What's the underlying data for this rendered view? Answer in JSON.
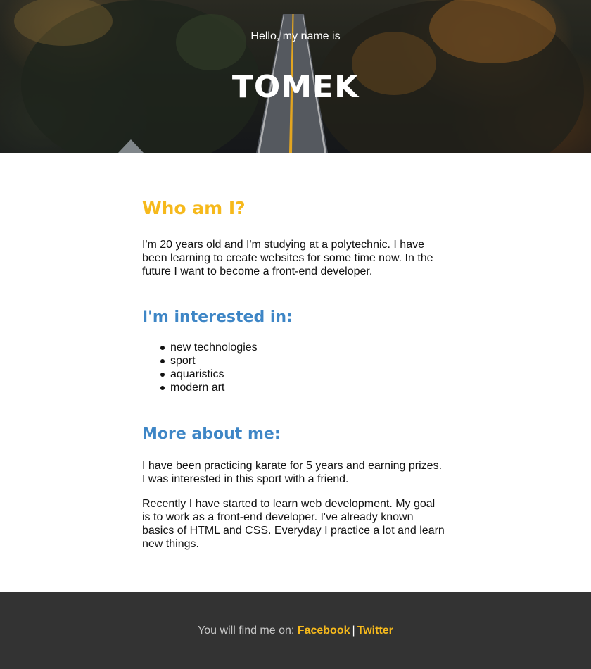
{
  "hero": {
    "greeting": "Hello, my name is",
    "name": "TOMEK"
  },
  "about": {
    "heading": "Who am I?",
    "text": "I'm 20 years old and I'm studying at a polytechnic. I have been learning to create websites for some time now. In the future I want to become a front-end developer."
  },
  "interests": {
    "heading": "I'm interested in:",
    "items": [
      "new technologies",
      "sport",
      "aquaristics",
      "modern art"
    ]
  },
  "more": {
    "heading": "More about me:",
    "paragraph1": "I have been practicing karate for 5 years and earning prizes. I was interested in this sport with a friend.",
    "paragraph2": "Recently I have started to learn web development. My goal is to work as a front-end developer. I've already known basics of HTML and CSS. Everyday I practice a lot and learn new things."
  },
  "footer": {
    "prefix": "You will find me on:",
    "separator": "|",
    "links": [
      "Facebook",
      "Twitter"
    ]
  },
  "colors": {
    "accent_yellow": "#f6b91c",
    "accent_blue": "#3e86c6",
    "footer_bg": "#333333"
  }
}
